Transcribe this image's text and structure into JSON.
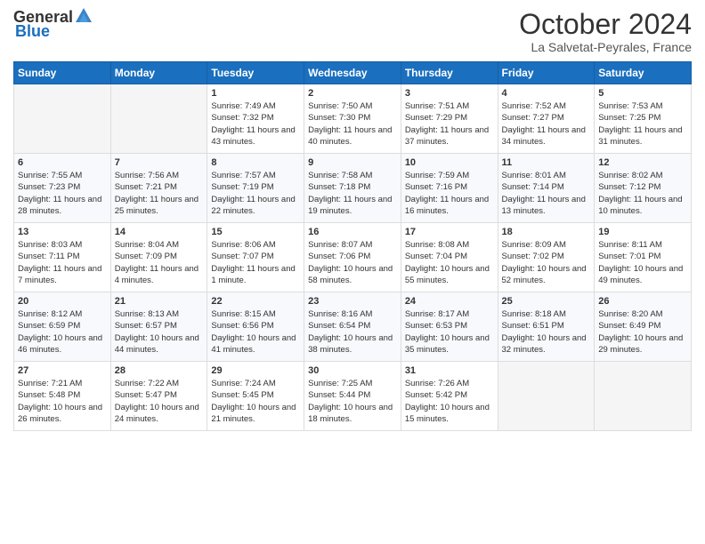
{
  "header": {
    "logo_general": "General",
    "logo_blue": "Blue",
    "month_title": "October 2024",
    "location": "La Salvetat-Peyrales, France"
  },
  "days_of_week": [
    "Sunday",
    "Monday",
    "Tuesday",
    "Wednesday",
    "Thursday",
    "Friday",
    "Saturday"
  ],
  "weeks": [
    [
      {
        "day": "",
        "sunrise": "",
        "sunset": "",
        "daylight": ""
      },
      {
        "day": "",
        "sunrise": "",
        "sunset": "",
        "daylight": ""
      },
      {
        "day": "1",
        "sunrise": "Sunrise: 7:49 AM",
        "sunset": "Sunset: 7:32 PM",
        "daylight": "Daylight: 11 hours and 43 minutes."
      },
      {
        "day": "2",
        "sunrise": "Sunrise: 7:50 AM",
        "sunset": "Sunset: 7:30 PM",
        "daylight": "Daylight: 11 hours and 40 minutes."
      },
      {
        "day": "3",
        "sunrise": "Sunrise: 7:51 AM",
        "sunset": "Sunset: 7:29 PM",
        "daylight": "Daylight: 11 hours and 37 minutes."
      },
      {
        "day": "4",
        "sunrise": "Sunrise: 7:52 AM",
        "sunset": "Sunset: 7:27 PM",
        "daylight": "Daylight: 11 hours and 34 minutes."
      },
      {
        "day": "5",
        "sunrise": "Sunrise: 7:53 AM",
        "sunset": "Sunset: 7:25 PM",
        "daylight": "Daylight: 11 hours and 31 minutes."
      }
    ],
    [
      {
        "day": "6",
        "sunrise": "Sunrise: 7:55 AM",
        "sunset": "Sunset: 7:23 PM",
        "daylight": "Daylight: 11 hours and 28 minutes."
      },
      {
        "day": "7",
        "sunrise": "Sunrise: 7:56 AM",
        "sunset": "Sunset: 7:21 PM",
        "daylight": "Daylight: 11 hours and 25 minutes."
      },
      {
        "day": "8",
        "sunrise": "Sunrise: 7:57 AM",
        "sunset": "Sunset: 7:19 PM",
        "daylight": "Daylight: 11 hours and 22 minutes."
      },
      {
        "day": "9",
        "sunrise": "Sunrise: 7:58 AM",
        "sunset": "Sunset: 7:18 PM",
        "daylight": "Daylight: 11 hours and 19 minutes."
      },
      {
        "day": "10",
        "sunrise": "Sunrise: 7:59 AM",
        "sunset": "Sunset: 7:16 PM",
        "daylight": "Daylight: 11 hours and 16 minutes."
      },
      {
        "day": "11",
        "sunrise": "Sunrise: 8:01 AM",
        "sunset": "Sunset: 7:14 PM",
        "daylight": "Daylight: 11 hours and 13 minutes."
      },
      {
        "day": "12",
        "sunrise": "Sunrise: 8:02 AM",
        "sunset": "Sunset: 7:12 PM",
        "daylight": "Daylight: 11 hours and 10 minutes."
      }
    ],
    [
      {
        "day": "13",
        "sunrise": "Sunrise: 8:03 AM",
        "sunset": "Sunset: 7:11 PM",
        "daylight": "Daylight: 11 hours and 7 minutes."
      },
      {
        "day": "14",
        "sunrise": "Sunrise: 8:04 AM",
        "sunset": "Sunset: 7:09 PM",
        "daylight": "Daylight: 11 hours and 4 minutes."
      },
      {
        "day": "15",
        "sunrise": "Sunrise: 8:06 AM",
        "sunset": "Sunset: 7:07 PM",
        "daylight": "Daylight: 11 hours and 1 minute."
      },
      {
        "day": "16",
        "sunrise": "Sunrise: 8:07 AM",
        "sunset": "Sunset: 7:06 PM",
        "daylight": "Daylight: 10 hours and 58 minutes."
      },
      {
        "day": "17",
        "sunrise": "Sunrise: 8:08 AM",
        "sunset": "Sunset: 7:04 PM",
        "daylight": "Daylight: 10 hours and 55 minutes."
      },
      {
        "day": "18",
        "sunrise": "Sunrise: 8:09 AM",
        "sunset": "Sunset: 7:02 PM",
        "daylight": "Daylight: 10 hours and 52 minutes."
      },
      {
        "day": "19",
        "sunrise": "Sunrise: 8:11 AM",
        "sunset": "Sunset: 7:01 PM",
        "daylight": "Daylight: 10 hours and 49 minutes."
      }
    ],
    [
      {
        "day": "20",
        "sunrise": "Sunrise: 8:12 AM",
        "sunset": "Sunset: 6:59 PM",
        "daylight": "Daylight: 10 hours and 46 minutes."
      },
      {
        "day": "21",
        "sunrise": "Sunrise: 8:13 AM",
        "sunset": "Sunset: 6:57 PM",
        "daylight": "Daylight: 10 hours and 44 minutes."
      },
      {
        "day": "22",
        "sunrise": "Sunrise: 8:15 AM",
        "sunset": "Sunset: 6:56 PM",
        "daylight": "Daylight: 10 hours and 41 minutes."
      },
      {
        "day": "23",
        "sunrise": "Sunrise: 8:16 AM",
        "sunset": "Sunset: 6:54 PM",
        "daylight": "Daylight: 10 hours and 38 minutes."
      },
      {
        "day": "24",
        "sunrise": "Sunrise: 8:17 AM",
        "sunset": "Sunset: 6:53 PM",
        "daylight": "Daylight: 10 hours and 35 minutes."
      },
      {
        "day": "25",
        "sunrise": "Sunrise: 8:18 AM",
        "sunset": "Sunset: 6:51 PM",
        "daylight": "Daylight: 10 hours and 32 minutes."
      },
      {
        "day": "26",
        "sunrise": "Sunrise: 8:20 AM",
        "sunset": "Sunset: 6:49 PM",
        "daylight": "Daylight: 10 hours and 29 minutes."
      }
    ],
    [
      {
        "day": "27",
        "sunrise": "Sunrise: 7:21 AM",
        "sunset": "Sunset: 5:48 PM",
        "daylight": "Daylight: 10 hours and 26 minutes."
      },
      {
        "day": "28",
        "sunrise": "Sunrise: 7:22 AM",
        "sunset": "Sunset: 5:47 PM",
        "daylight": "Daylight: 10 hours and 24 minutes."
      },
      {
        "day": "29",
        "sunrise": "Sunrise: 7:24 AM",
        "sunset": "Sunset: 5:45 PM",
        "daylight": "Daylight: 10 hours and 21 minutes."
      },
      {
        "day": "30",
        "sunrise": "Sunrise: 7:25 AM",
        "sunset": "Sunset: 5:44 PM",
        "daylight": "Daylight: 10 hours and 18 minutes."
      },
      {
        "day": "31",
        "sunrise": "Sunrise: 7:26 AM",
        "sunset": "Sunset: 5:42 PM",
        "daylight": "Daylight: 10 hours and 15 minutes."
      },
      {
        "day": "",
        "sunrise": "",
        "sunset": "",
        "daylight": ""
      },
      {
        "day": "",
        "sunrise": "",
        "sunset": "",
        "daylight": ""
      }
    ]
  ]
}
